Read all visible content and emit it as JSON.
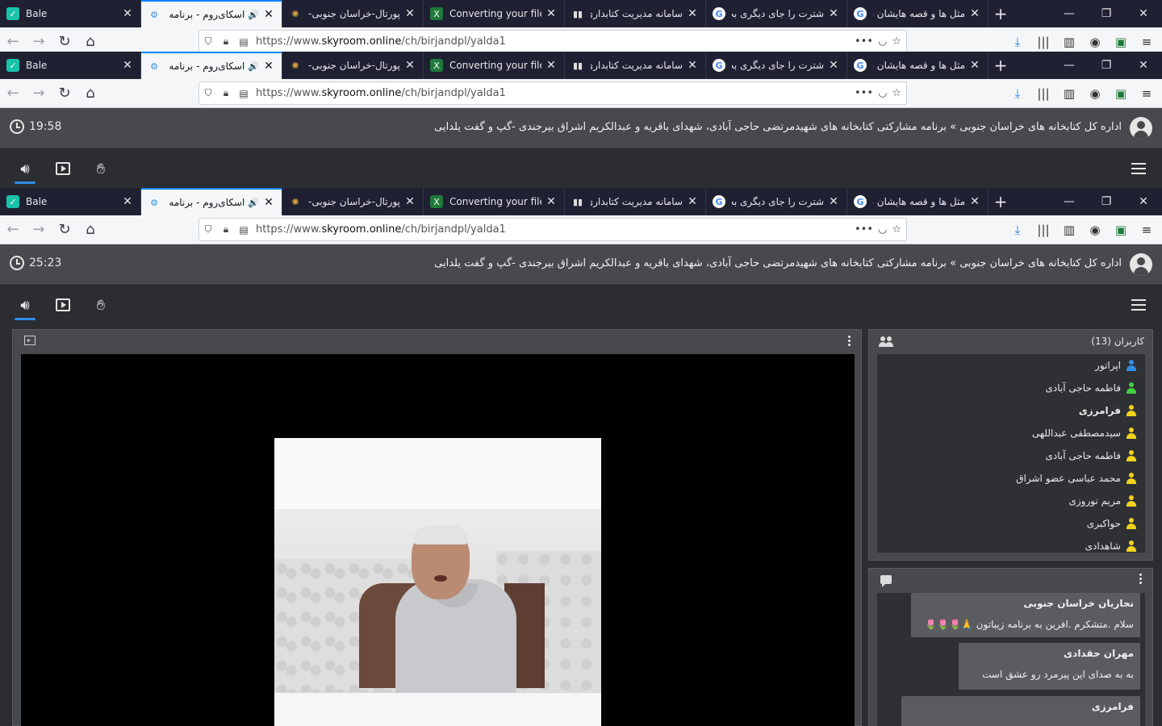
{
  "tabs": [
    {
      "title": "Bale",
      "favicon": "bale-icon",
      "dir": "ltr"
    },
    {
      "title": "اسکای‌روم - برنامه ه",
      "favicon": "skyroom-icon",
      "dir": "rtl",
      "active": true,
      "audio": "🔊"
    },
    {
      "title": "پورتال-خراسان جنوبی-خ",
      "favicon": "portal-icon",
      "dir": "rtl"
    },
    {
      "title": "Converting your file",
      "favicon": "converter-icon",
      "dir": "ltr"
    },
    {
      "title": "سامانه مدیریت کتابداری",
      "favicon": "library-icon",
      "dir": "rtl"
    },
    {
      "title": "شترت را جای دیگری بخو",
      "favicon": "google-icon",
      "dir": "rtl"
    },
    {
      "title": "مثل ها و قصه هایشان د",
      "favicon": "google-icon",
      "dir": "rtl"
    }
  ],
  "nav": {
    "url_prefix": "https://www.",
    "url_domain": "skyroom.online",
    "url_path": "/ch/birjandpl/yalda1",
    "more": "•••"
  },
  "room": {
    "title": "اداره کل کتابخانه های خراسان جنوبی » برنامه مشارکتی کتابخانه های شهیدمرتضی حاجی آبادی، شهدای باقریه و عبدالکریم اشراق بیرجندی -گپ و گفت یلدایی",
    "timers": [
      "19:58",
      "25:23"
    ]
  },
  "users": {
    "title": "کاربران (13)",
    "list": [
      {
        "name": "اپراتور",
        "color": "#2f8ee8"
      },
      {
        "name": "فاطمه حاجی آبادی",
        "color": "#3fd13f"
      },
      {
        "name": "فرامرزی",
        "color": "#f2d21b",
        "bold": true
      },
      {
        "name": "سیدمصطفی عبداللهی",
        "color": "#f2d21b"
      },
      {
        "name": "فاطمه حاجی آبادی",
        "color": "#f2d21b"
      },
      {
        "name": "محمد عباسی عضو اشراق",
        "color": "#f2d21b"
      },
      {
        "name": "مریم نوروزی",
        "color": "#f2d21b"
      },
      {
        "name": "حواکبری",
        "color": "#f2d21b"
      },
      {
        "name": "شاهدادی",
        "color": "#f2d21b"
      }
    ]
  },
  "chat": {
    "messages": [
      {
        "sender": "نجاریان خراسان جنوبی",
        "text": "سلام .متشکرم .افرین به برنامه زیباتون 🙏🌷🌷🌷"
      },
      {
        "sender": "مهران حقدادی",
        "text": "به به صدای این پیرمرد رو عشق است"
      },
      {
        "sender": "فرامرزی",
        "text": ""
      }
    ]
  }
}
